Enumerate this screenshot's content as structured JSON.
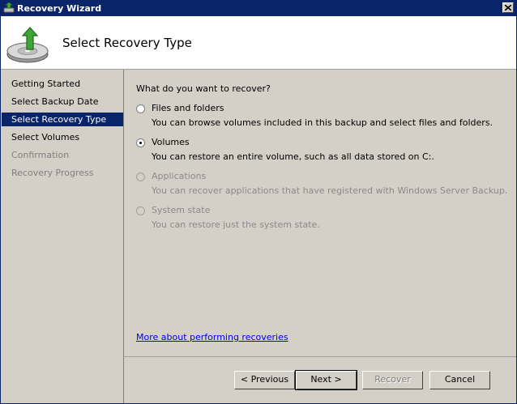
{
  "window": {
    "title": "Recovery Wizard"
  },
  "header": {
    "title": "Select Recovery Type"
  },
  "steps": [
    {
      "label": "Getting Started",
      "state": "done"
    },
    {
      "label": "Select Backup Date",
      "state": "done"
    },
    {
      "label": "Select Recovery Type",
      "state": "active"
    },
    {
      "label": "Select Volumes",
      "state": "done"
    },
    {
      "label": "Confirmation",
      "state": "pending"
    },
    {
      "label": "Recovery Progress",
      "state": "pending"
    }
  ],
  "content": {
    "question": "What do you want to recover?",
    "options": [
      {
        "label": "Files and folders",
        "description": "You can browse volumes included in this backup and select files and folders.",
        "checked": false,
        "enabled": true
      },
      {
        "label": "Volumes",
        "description": "You can restore an entire volume, such as all data stored on C:.",
        "checked": true,
        "enabled": true
      },
      {
        "label": "Applications",
        "description": "You can recover applications that have registered with Windows Server Backup.",
        "checked": false,
        "enabled": false
      },
      {
        "label": "System state",
        "description": "You can restore just the system state.",
        "checked": false,
        "enabled": false
      }
    ],
    "more_link": "More about performing recoveries"
  },
  "buttons": {
    "previous": "< Previous",
    "next": "Next >",
    "recover": "Recover",
    "cancel": "Cancel"
  },
  "colors": {
    "titlebar": "#0a246a",
    "selection": "#0a246a",
    "face": "#d4d0c8",
    "link": "#0000ee"
  },
  "icons": {
    "window": "backup-app-icon",
    "header": "disk-recovery-icon",
    "close": "close-icon"
  }
}
